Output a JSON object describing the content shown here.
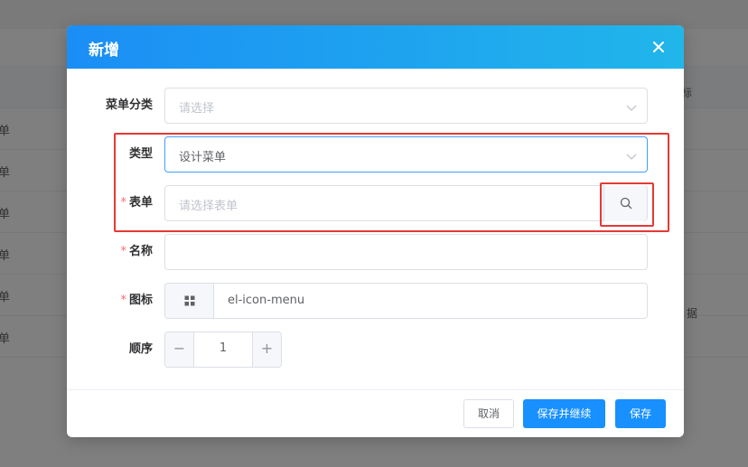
{
  "background": {
    "rows": [
      "单",
      "单",
      "单",
      "单",
      "单",
      "单"
    ],
    "right_texts": [
      "标",
      "据"
    ]
  },
  "dialog": {
    "title": "新增",
    "close_icon": "close-icon"
  },
  "form": {
    "category": {
      "label": "菜单分类",
      "placeholder": "请选择"
    },
    "type": {
      "label": "类型",
      "value": "设计菜单"
    },
    "form_field": {
      "label": "表单",
      "required_mark": "*",
      "placeholder": "请选择表单"
    },
    "name": {
      "label": "名称",
      "required_mark": "*",
      "value": ""
    },
    "icon": {
      "label": "图标",
      "required_mark": "*",
      "value": "el-icon-menu",
      "icon_name": "menu-grid-icon"
    },
    "order": {
      "label": "顺序",
      "value": "1",
      "minus": "−",
      "plus": "+"
    }
  },
  "footer": {
    "cancel": "取消",
    "save_continue": "保存并继续",
    "save": "保存"
  },
  "colors": {
    "primary": "#1890ff",
    "header_start": "#1b8ef5",
    "header_end": "#21b6ea",
    "highlight": "#e53935",
    "required": "#f56c6c"
  }
}
